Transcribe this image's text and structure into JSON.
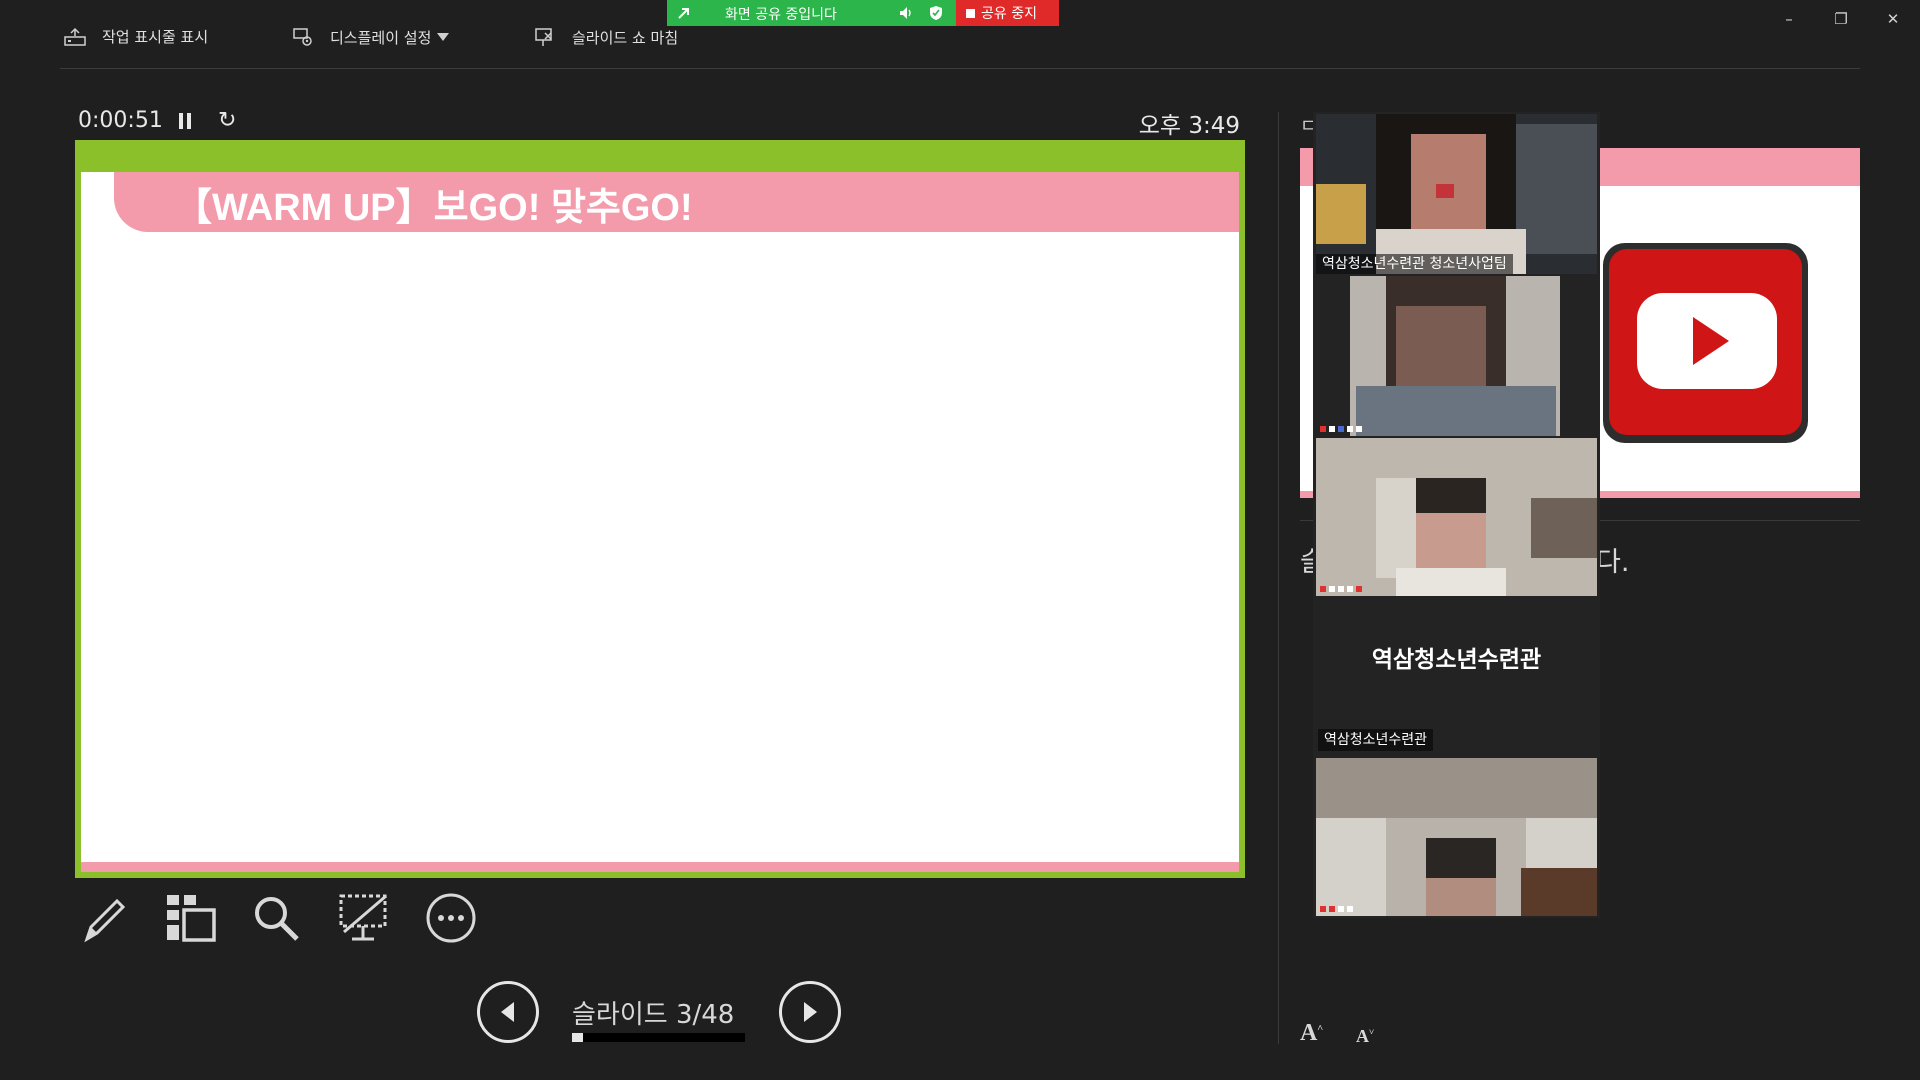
{
  "toolbar": {
    "show_taskbar": "작업 표시줄 표시",
    "display_settings": "디스플레이 설정",
    "end_show": "슬라이드 쇼 마침"
  },
  "share_banner": {
    "status": "화면 공유 중입니다",
    "stop": "공유 중지",
    "green_color": "#2bb54a",
    "red_color": "#e02a2a"
  },
  "timer": {
    "elapsed": "0:00:51",
    "restart_glyph": "↻",
    "clock": "오후 3:49"
  },
  "slide": {
    "title": "【WARM UP】보GO! 맞추GO!",
    "frame_color": "#8cc02a",
    "accent_color": "#f39aab"
  },
  "navigation": {
    "counter": "슬라이드 3/48",
    "progress_fraction": 0.0625
  },
  "next_slide": {
    "label_fragment": "ㄷ",
    "notes_left_fragment": "슬",
    "notes_fragment": "다."
  },
  "font_buttons": {
    "increase": "A",
    "decrease": "A"
  },
  "participants": {
    "tile1_name": "역삼청소년수련관 청소년사업팀",
    "name_tile_text": "역삼청소년수련관",
    "name_tile_label": "역삼청소년수련관"
  },
  "window_controls": {
    "minimize": "–",
    "restore": "❐",
    "close": "✕"
  }
}
